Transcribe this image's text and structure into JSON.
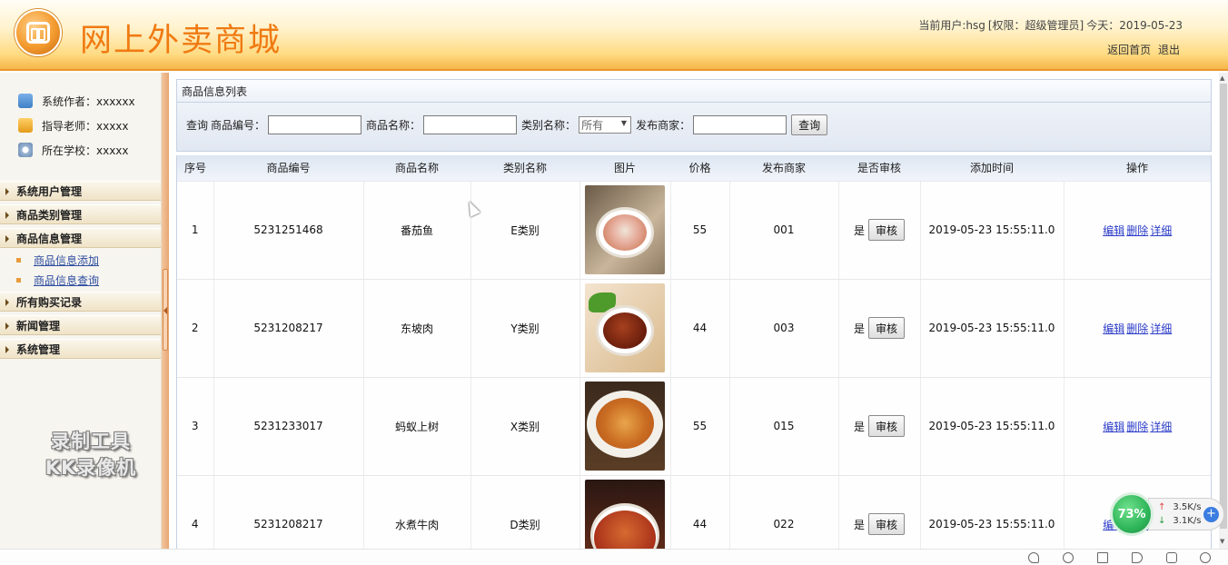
{
  "header": {
    "site_title": "网上外卖商城",
    "current_user_label": "当前用户:hsg",
    "role_label": "[权限：超级管理员]",
    "today_label": "今天：2019-05-23",
    "home_link": "返回首页",
    "logout_link": "退出"
  },
  "sidebar": {
    "author": "系统作者：xxxxxx",
    "teacher": "指导老师：xxxxx",
    "school": "所在学校：xxxxx",
    "menus": [
      {
        "label": "系统用户管理"
      },
      {
        "label": "商品类别管理"
      },
      {
        "label": "商品信息管理"
      },
      {
        "label": "所有购买记录"
      },
      {
        "label": "新闻管理"
      },
      {
        "label": "系统管理"
      }
    ],
    "submenu": [
      {
        "label": "商品信息添加"
      },
      {
        "label": "商品信息查询"
      }
    ]
  },
  "watermark": {
    "line1": "录制工具",
    "line2": "KK录像机"
  },
  "main": {
    "panel_title": "商品信息列表",
    "search": {
      "prefix": "查询",
      "code_label": "商品编号：",
      "name_label": "商品名称：",
      "category_label": "类别名称：",
      "category_value": "所有",
      "merchant_label": "发布商家：",
      "query_button": "查询"
    },
    "columns": [
      "序号",
      "商品编号",
      "商品名称",
      "类别名称",
      "图片",
      "价格",
      "发布商家",
      "是否审核",
      "添加时间",
      "操作"
    ],
    "rows": [
      {
        "no": "1",
        "code": "5231251468",
        "name": "番茄鱼",
        "category": "E类别",
        "price": "55",
        "merchant": "001",
        "audited": "是",
        "time": "2019-05-23 15:55:11.0"
      },
      {
        "no": "2",
        "code": "5231208217",
        "name": "东坡肉",
        "category": "Y类别",
        "price": "44",
        "merchant": "003",
        "audited": "是",
        "time": "2019-05-23 15:55:11.0"
      },
      {
        "no": "3",
        "code": "5231233017",
        "name": "蚂蚁上树",
        "category": "X类别",
        "price": "55",
        "merchant": "015",
        "audited": "是",
        "time": "2019-05-23 15:55:11.0"
      },
      {
        "no": "4",
        "code": "5231208217",
        "name": "水煮牛肉",
        "category": "D类别",
        "price": "44",
        "merchant": "022",
        "audited": "是",
        "time": "2019-05-23 15:55:11.0"
      }
    ],
    "audit_button": "审核",
    "op_edit": "编辑",
    "op_delete": "删除",
    "op_detail": "详细"
  },
  "net_widget": {
    "percent": "73%",
    "up": "3.5K/s",
    "down": "3.1K/s"
  },
  "colors": {
    "title": "#f07a12",
    "link": "#2b3cc8",
    "accent": "#e9962e"
  }
}
